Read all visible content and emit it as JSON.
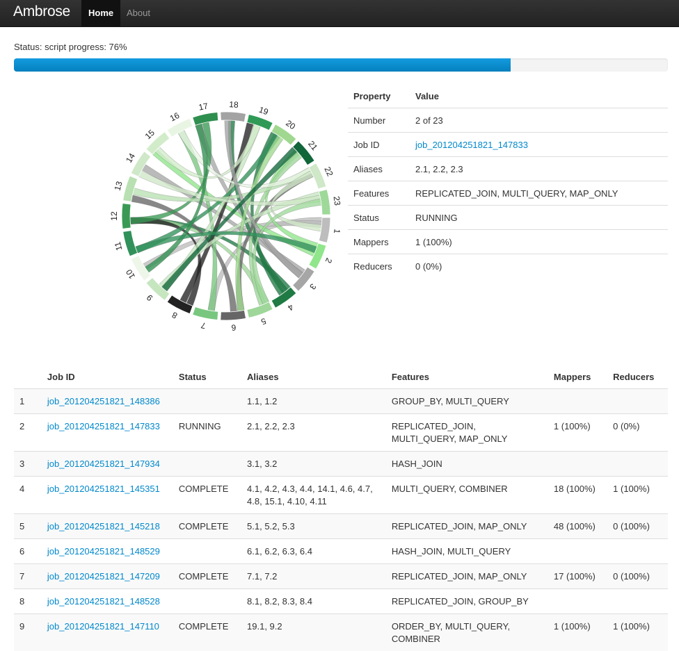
{
  "nav": {
    "brand": "Ambrose",
    "tabs": [
      {
        "label": "Home",
        "active": true
      },
      {
        "label": "About",
        "active": false
      }
    ]
  },
  "status": {
    "text": "Status: script progress: 76%",
    "progress": 0.76
  },
  "colors": {
    "progress": "#0e8fd3",
    "link": "#0088cc",
    "navbar": "#222222"
  },
  "chord": {
    "labels": [
      "1",
      "2",
      "3",
      "4",
      "5",
      "6",
      "7",
      "8",
      "9",
      "10",
      "11",
      "12",
      "13",
      "14",
      "15",
      "16",
      "17",
      "18",
      "19",
      "20",
      "21",
      "22",
      "23"
    ],
    "segment_colors": [
      "#bdbdbd",
      "#90e68a",
      "#a6a6a6",
      "#1f7a44",
      "#9fd69a",
      "#666666",
      "#79c77f",
      "#222222",
      "#c6e6c0",
      "#eef6ea",
      "#31915a",
      "#3a9a55",
      "#b8e0b2",
      "#cfe8c8",
      "#d2ecca",
      "#e8f5e3",
      "#2f8f4f",
      "#a3a3a3",
      "#2f9a55",
      "#9fd88e",
      "#11663a",
      "#cfe8c8",
      "#9ed99a"
    ]
  },
  "properties": {
    "header": {
      "property": "Property",
      "value": "Value"
    },
    "rows": [
      {
        "key": "Number",
        "value": "2 of 23",
        "link": false
      },
      {
        "key": "Job ID",
        "value": "job_201204251821_147833",
        "link": true
      },
      {
        "key": "Aliases",
        "value": "2.1, 2.2, 2.3",
        "link": false
      },
      {
        "key": "Features",
        "value": "REPLICATED_JOIN, MULTI_QUERY, MAP_ONLY",
        "link": false
      },
      {
        "key": "Status",
        "value": "RUNNING",
        "link": false
      },
      {
        "key": "Mappers",
        "value": "1 (100%)",
        "link": false
      },
      {
        "key": "Reducers",
        "value": "0 (0%)",
        "link": false
      }
    ]
  },
  "jobs": {
    "headers": [
      "",
      "Job ID",
      "Status",
      "Aliases",
      "Features",
      "Mappers",
      "Reducers"
    ],
    "rows": [
      {
        "num": "1",
        "id": "job_201204251821_148386",
        "status": "",
        "aliases": "1.1, 1.2",
        "features": "GROUP_BY, MULTI_QUERY",
        "mappers": "",
        "reducers": ""
      },
      {
        "num": "2",
        "id": "job_201204251821_147833",
        "status": "RUNNING",
        "aliases": "2.1, 2.2, 2.3",
        "features": "REPLICATED_JOIN, MULTI_QUERY, MAP_ONLY",
        "mappers": "1 (100%)",
        "reducers": "0 (0%)"
      },
      {
        "num": "3",
        "id": "job_201204251821_147934",
        "status": "",
        "aliases": "3.1, 3.2",
        "features": "HASH_JOIN",
        "mappers": "",
        "reducers": ""
      },
      {
        "num": "4",
        "id": "job_201204251821_145351",
        "status": "COMPLETE",
        "aliases": "4.1, 4.2, 4.3, 4.4, 14.1, 4.6, 4.7, 4.8, 15.1, 4.10, 4.11",
        "features": "MULTI_QUERY, COMBINER",
        "mappers": "18 (100%)",
        "reducers": "1 (100%)"
      },
      {
        "num": "5",
        "id": "job_201204251821_145218",
        "status": "COMPLETE",
        "aliases": "5.1, 5.2, 5.3",
        "features": "REPLICATED_JOIN, MAP_ONLY",
        "mappers": "48 (100%)",
        "reducers": "0 (100%)"
      },
      {
        "num": "6",
        "id": "job_201204251821_148529",
        "status": "",
        "aliases": "6.1, 6.2, 6.3, 6.4",
        "features": "HASH_JOIN, MULTI_QUERY",
        "mappers": "",
        "reducers": ""
      },
      {
        "num": "7",
        "id": "job_201204251821_147209",
        "status": "COMPLETE",
        "aliases": "7.1, 7.2",
        "features": "REPLICATED_JOIN, MAP_ONLY",
        "mappers": "17 (100%)",
        "reducers": "0 (100%)"
      },
      {
        "num": "8",
        "id": "job_201204251821_148528",
        "status": "",
        "aliases": "8.1, 8.2, 8.3, 8.4",
        "features": "REPLICATED_JOIN, GROUP_BY",
        "mappers": "",
        "reducers": ""
      },
      {
        "num": "9",
        "id": "job_201204251821_147110",
        "status": "COMPLETE",
        "aliases": "19.1, 9.2",
        "features": "ORDER_BY, MULTI_QUERY, COMBINER",
        "mappers": "1 (100%)",
        "reducers": "1 (100%)"
      }
    ]
  }
}
